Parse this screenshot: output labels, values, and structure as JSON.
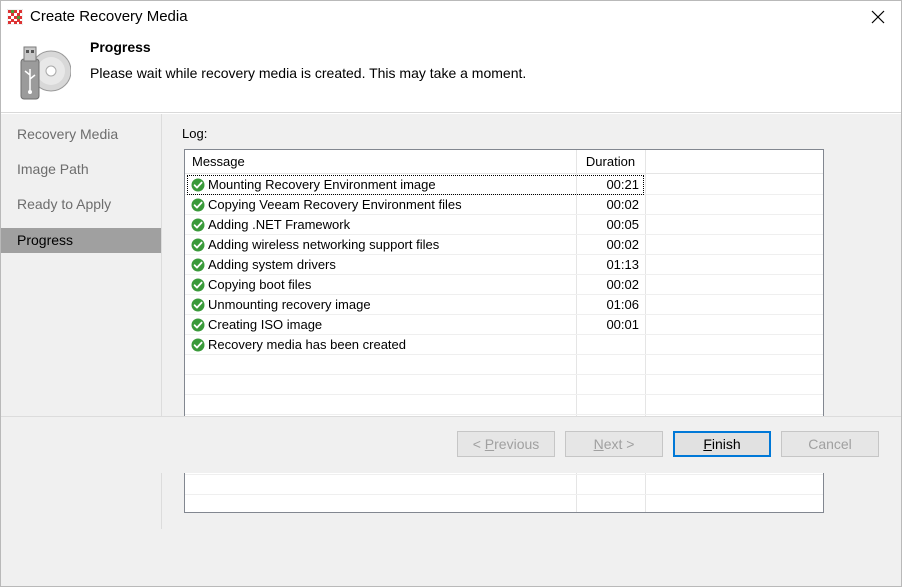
{
  "window": {
    "title": "Create Recovery Media",
    "icon": "veeam-app-icon",
    "close_icon": "close-icon"
  },
  "header": {
    "title": "Progress",
    "description": "Please wait while recovery media is created. This may take a moment.",
    "icon": "recovery-media-disk-usb-icon"
  },
  "sidebar": {
    "items": [
      {
        "label": "Recovery Media",
        "active": false
      },
      {
        "label": "Image Path",
        "active": false
      },
      {
        "label": "Ready to Apply",
        "active": false
      },
      {
        "label": "Progress",
        "active": true
      }
    ]
  },
  "log": {
    "label": "Log:",
    "columns": {
      "message": "Message",
      "duration": "Duration"
    },
    "rows": [
      {
        "message": "Mounting Recovery Environment image",
        "duration": "00:21",
        "status": "success"
      },
      {
        "message": "Copying Veeam Recovery Environment files",
        "duration": "00:02",
        "status": "success"
      },
      {
        "message": "Adding .NET Framework",
        "duration": "00:05",
        "status": "success"
      },
      {
        "message": "Adding wireless networking support files",
        "duration": "00:02",
        "status": "success"
      },
      {
        "message": "Adding system drivers",
        "duration": "01:13",
        "status": "success"
      },
      {
        "message": "Copying boot files",
        "duration": "00:02",
        "status": "success"
      },
      {
        "message": "Unmounting recovery image",
        "duration": "01:06",
        "status": "success"
      },
      {
        "message": "Creating ISO image",
        "duration": "00:01",
        "status": "success"
      },
      {
        "message": "Recovery media has been created",
        "duration": "",
        "status": "success"
      }
    ],
    "empty_rows": 8
  },
  "buttons": {
    "previous": {
      "pre": "< ",
      "key": "P",
      "rest": "revious",
      "enabled": false
    },
    "next": {
      "pre": "",
      "key": "N",
      "rest": "ext >",
      "enabled": false
    },
    "finish": {
      "pre": "",
      "key": "F",
      "rest": "inish",
      "enabled": true
    },
    "cancel": {
      "label": "Cancel",
      "enabled": false
    }
  },
  "colors": {
    "accent": "#0078d7",
    "success": "#3a9a3a",
    "sidebar_active": "#a0a0a0"
  }
}
